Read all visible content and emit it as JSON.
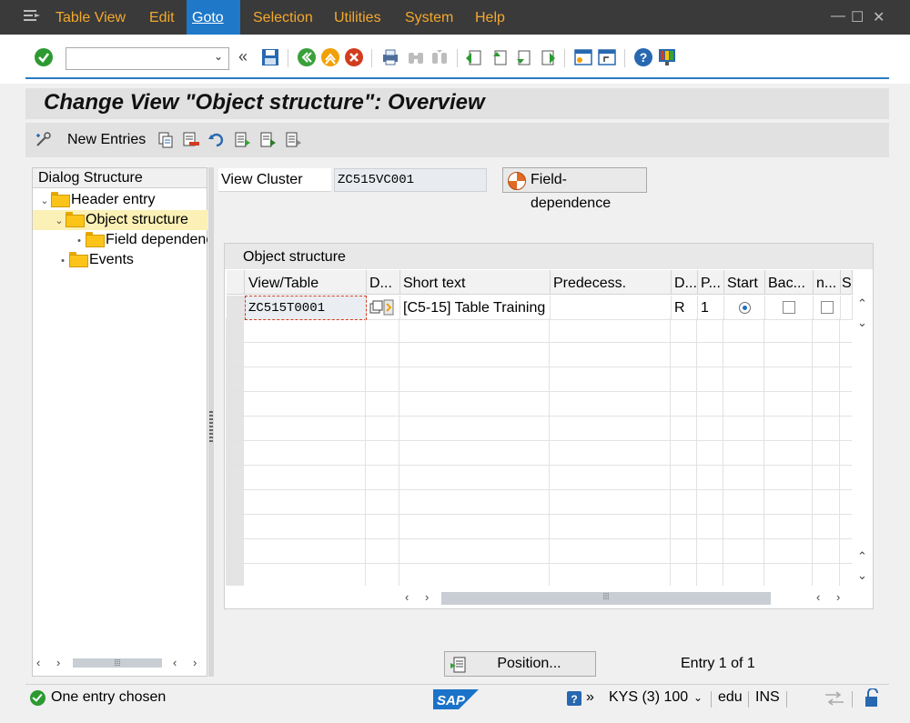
{
  "menu": {
    "items": [
      {
        "label": "Table View",
        "active": false
      },
      {
        "label": "Edit",
        "active": false
      },
      {
        "label": "Goto",
        "active": true
      },
      {
        "label": "Selection",
        "active": false
      },
      {
        "label": "Utilities",
        "active": false
      },
      {
        "label": "System",
        "active": false
      },
      {
        "label": "Help",
        "active": false
      }
    ],
    "window_controls": [
      "—",
      "☐",
      "✕"
    ]
  },
  "toolbar": {
    "command_field": {
      "value": "",
      "placeholder": ""
    },
    "history_glyph": "«"
  },
  "title": "Change View \"Object structure\": Overview",
  "app_toolbar": {
    "new_entries_label": "New Entries"
  },
  "dialog_structure": {
    "header": "Dialog Structure",
    "nodes": [
      {
        "label": "Header entry",
        "level": 0,
        "expanded": true,
        "selected": false
      },
      {
        "label": "Object structure",
        "level": 1,
        "expanded": true,
        "selected": true
      },
      {
        "label": "Field dependence",
        "level": 2,
        "expanded": false,
        "selected": false
      },
      {
        "label": "Events",
        "level": 1,
        "expanded": false,
        "selected": false
      }
    ]
  },
  "view_cluster": {
    "label": "View Cluster",
    "value": "ZC515VC001"
  },
  "field_dependence_button": "Field-dependence",
  "table": {
    "title": "Object structure",
    "columns": [
      "View/Table",
      "D...",
      "Short text",
      "Predecess.",
      "D...",
      "P...",
      "Start",
      "Bac...",
      "n...",
      "S"
    ],
    "rows": [
      {
        "view_table": "ZC515T0001",
        "short_text": "[C5-15] Table Training",
        "predecessor": "",
        "d": "R",
        "p": "1",
        "start_selected": true,
        "bac_checked": false,
        "n_checked": false
      }
    ]
  },
  "position_button": "Position...",
  "entry_count": "Entry 1 of 1",
  "status": {
    "message": "One entry chosen",
    "system": "KYS (3) 100",
    "client_user": "edu",
    "mode": "INS",
    "logo_text": "SAP"
  },
  "colors": {
    "menubar_bg": "#3a3a3a",
    "menu_text": "#f4a82c",
    "menu_active_bg": "#1f78c8",
    "selected_node_bg": "#fbf0b5",
    "accent_line": "#2d7cc1"
  }
}
